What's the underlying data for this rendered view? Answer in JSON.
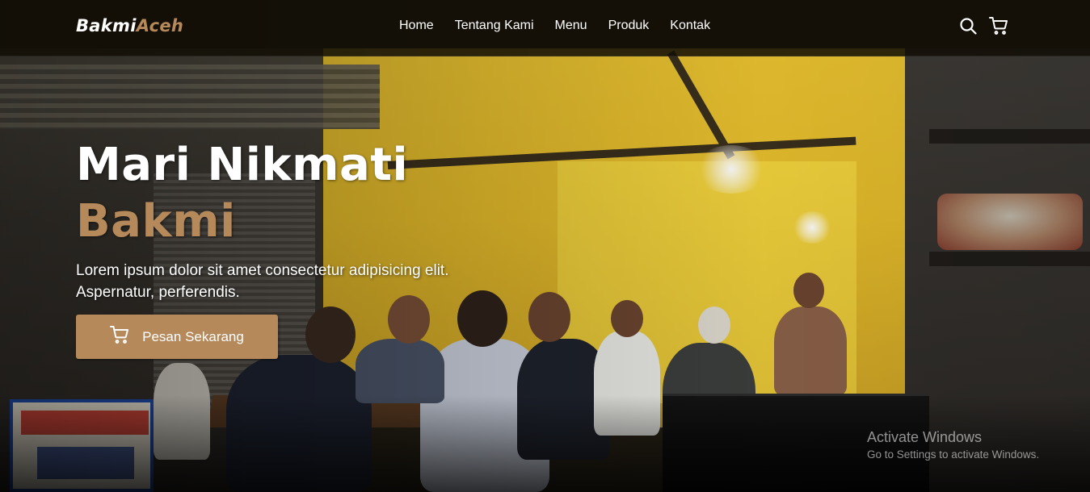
{
  "brand": {
    "name_part1": "Bakmi",
    "name_part2": "Aceh"
  },
  "nav": {
    "links": [
      {
        "label": "Home"
      },
      {
        "label": "Tentang Kami"
      },
      {
        "label": "Menu"
      },
      {
        "label": "Produk"
      },
      {
        "label": "Kontak"
      }
    ],
    "icons": [
      "search-icon",
      "shopping-cart-icon"
    ]
  },
  "hero": {
    "title_line1": "Mari Nikmati",
    "title_line2": "Bakmi",
    "description": "Lorem ipsum dolor sit amet consectetur adipisicing elit. Aspernatur, perferendis.",
    "cta_label": "Pesan Sekarang",
    "cta_icon": "shopping-cart-icon"
  },
  "watermark": {
    "title": "Activate Windows",
    "subtitle": "Go to Settings to activate Windows."
  },
  "colors": {
    "accent": "#b6895b",
    "navbar_bg": "#120e06",
    "text": "#ffffff"
  }
}
